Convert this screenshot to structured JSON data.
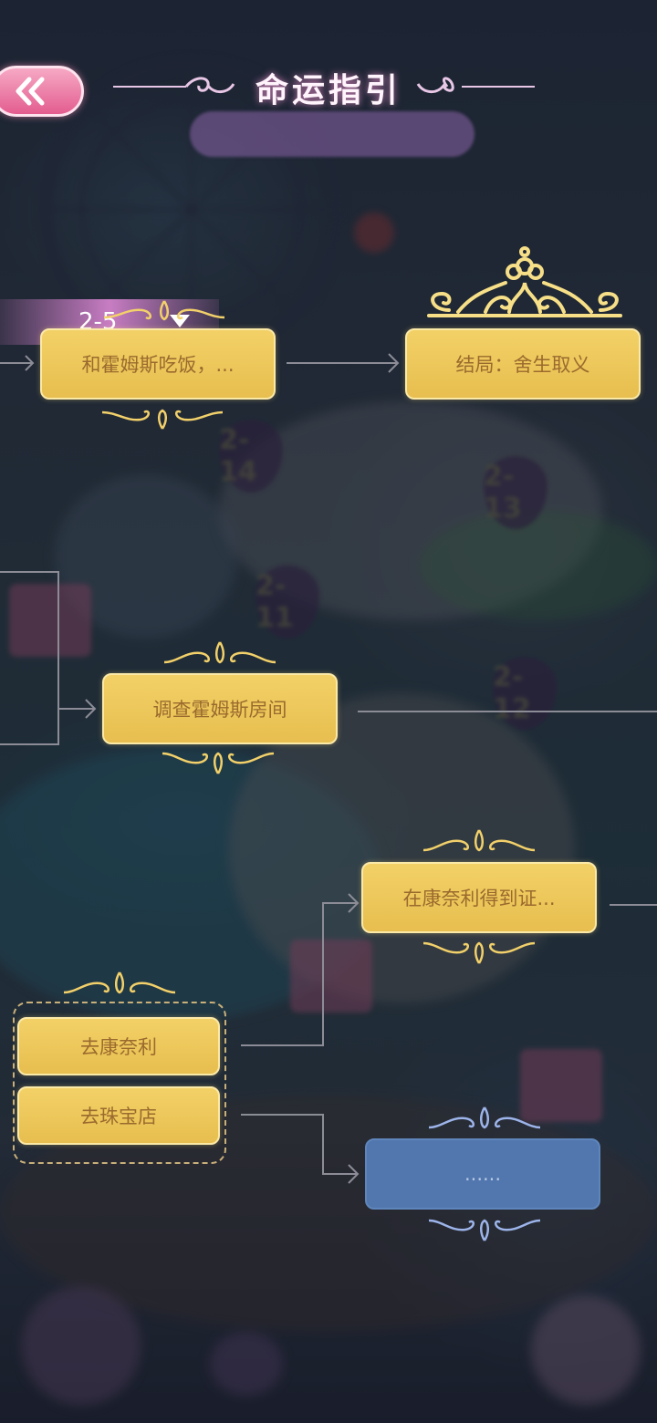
{
  "header": {
    "title": "命运指引",
    "back_icon": "double-chevron-left-icon"
  },
  "tree": {
    "chapter_tag": "2-5",
    "nodes": {
      "dinner": "和霍姆斯吃饭，...",
      "ending": "结局：舍生取义",
      "investigate": "调查霍姆斯房间",
      "evidence": "在康奈利得到证...",
      "go_connelly": "去康奈利",
      "go_jewelry": "去珠宝店",
      "locked": "......"
    }
  },
  "colors": {
    "node_gold": "#f0cb5e",
    "node_text": "#9a6a2e",
    "node_locked": "#5177ae",
    "back_pink": "#e35d8f"
  }
}
